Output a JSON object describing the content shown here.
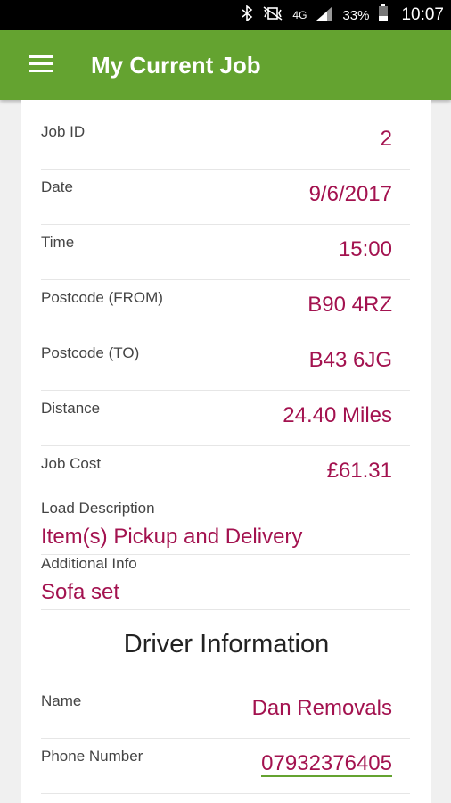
{
  "status_bar": {
    "bluetooth_icon": "bluetooth-icon",
    "mute_icon": "vibrate-mute-icon",
    "network": "4G",
    "battery": "33%",
    "time": "10:07"
  },
  "app_bar": {
    "menu_icon": "hamburger-menu-icon",
    "title": "My Current Job"
  },
  "job": {
    "job_id_label": "Job ID",
    "job_id": "2",
    "date_label": "Date",
    "date": "9/6/2017",
    "time_label": "Time",
    "time": "15:00",
    "postcode_from_label": "Postcode (FROM)",
    "postcode_from": "B90 4RZ",
    "postcode_to_label": "Postcode (TO)",
    "postcode_to": "B43 6JG",
    "distance_label": "Distance",
    "distance": "24.40 Miles",
    "cost_label": "Job Cost",
    "cost": "£61.31",
    "load_label": "Load Description",
    "load": "Item(s) Pickup and Delivery",
    "info_label": "Additional Info",
    "info": "Sofa set"
  },
  "driver": {
    "section_title": "Driver Information",
    "name_label": "Name",
    "name": "Dan Removals",
    "phone_label": "Phone Number",
    "phone": "07932376405"
  },
  "colors": {
    "accent": "#64a330",
    "value_text": "#a3124f"
  }
}
